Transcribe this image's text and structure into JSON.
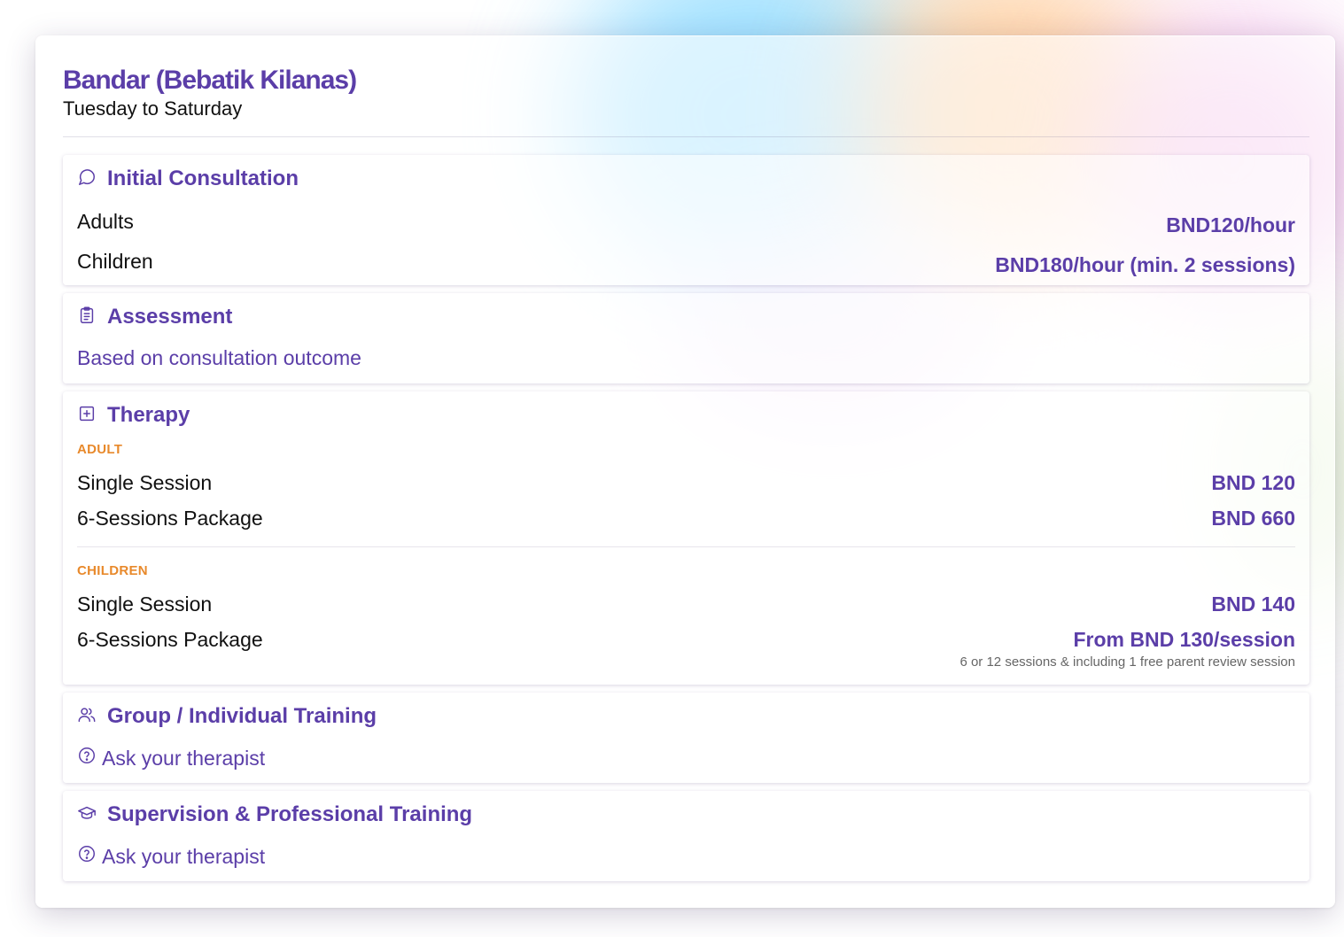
{
  "location": {
    "title": "Bandar (Bebatik Kilanas)",
    "days": "Tuesday to Saturday"
  },
  "colors": {
    "accent": "#5b3ea8",
    "category": "#e8892b",
    "text": "#111111",
    "muted": "#666666"
  },
  "sections": {
    "consultation": {
      "icon": "chat-bubble-icon",
      "title": "Initial Consultation",
      "rows": [
        {
          "label": "Adults",
          "value": "BND120/hour"
        },
        {
          "label": "Children",
          "value": "BND180/hour (min. 2 sessions)"
        }
      ]
    },
    "assessment": {
      "icon": "clipboard-icon",
      "title": "Assessment",
      "text": "Based on consultation outcome"
    },
    "therapy": {
      "icon": "plus-square-icon",
      "title": "Therapy",
      "adult": {
        "label": "ADULT",
        "rows": [
          {
            "label": "Single Session",
            "value": "BND 120"
          },
          {
            "label": "6-Sessions Package",
            "value": "BND 660"
          }
        ]
      },
      "children": {
        "label": "CHILDREN",
        "rows": [
          {
            "label": "Single Session",
            "value": "BND 140"
          },
          {
            "label": "6-Sessions Package",
            "value": "From BND 130/session"
          }
        ],
        "note": "6 or 12 sessions & including 1 free parent review session"
      }
    },
    "group_training": {
      "icon": "users-icon",
      "title": "Group / Individual Training",
      "text": "Ask your therapist"
    },
    "supervision": {
      "icon": "graduation-cap-icon",
      "title": "Supervision & Professional Training",
      "text": "Ask your therapist"
    }
  }
}
